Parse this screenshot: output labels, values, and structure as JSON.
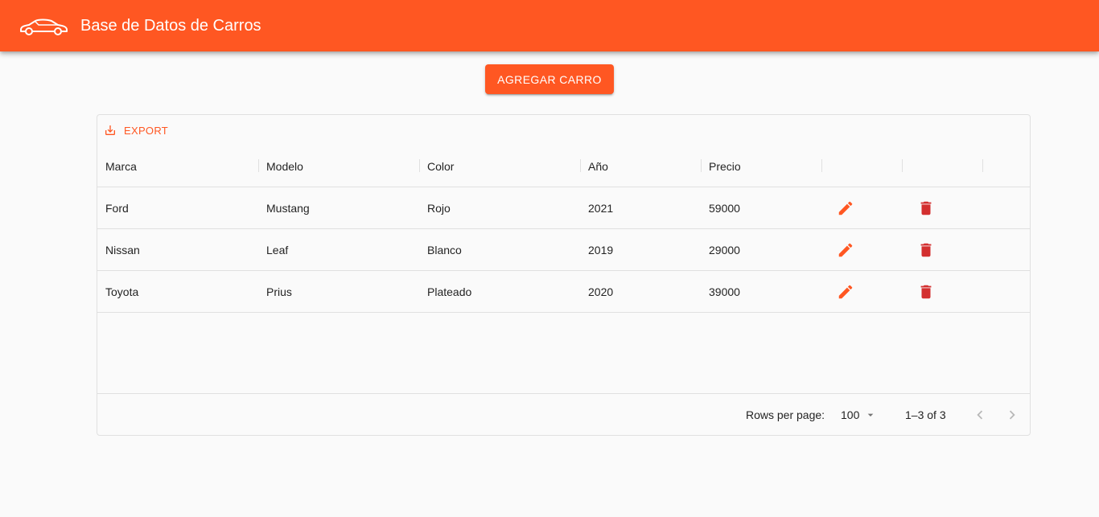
{
  "app": {
    "title": "Base de Datos de Carros",
    "accent": "#ff5722"
  },
  "actions": {
    "add_label": "Agregar carro"
  },
  "toolbar": {
    "export_label": "EXPORT"
  },
  "table": {
    "columns": [
      "Marca",
      "Modelo",
      "Color",
      "Año",
      "Precio"
    ],
    "rows": [
      {
        "marca": "Ford",
        "modelo": "Mustang",
        "color": "Rojo",
        "anio": "2021",
        "precio": "59000"
      },
      {
        "marca": "Nissan",
        "modelo": "Leaf",
        "color": "Blanco",
        "anio": "2019",
        "precio": "29000"
      },
      {
        "marca": "Toyota",
        "modelo": "Prius",
        "color": "Plateado",
        "anio": "2020",
        "precio": "39000"
      }
    ],
    "edit_icon": "pencil-icon",
    "delete_icon": "trash-icon",
    "edit_color": "#ff5722",
    "delete_color": "#d32f2f"
  },
  "pagination": {
    "rows_per_page_label": "Rows per page:",
    "rows_per_page_value": "100",
    "range_text": "1–3 of 3"
  }
}
